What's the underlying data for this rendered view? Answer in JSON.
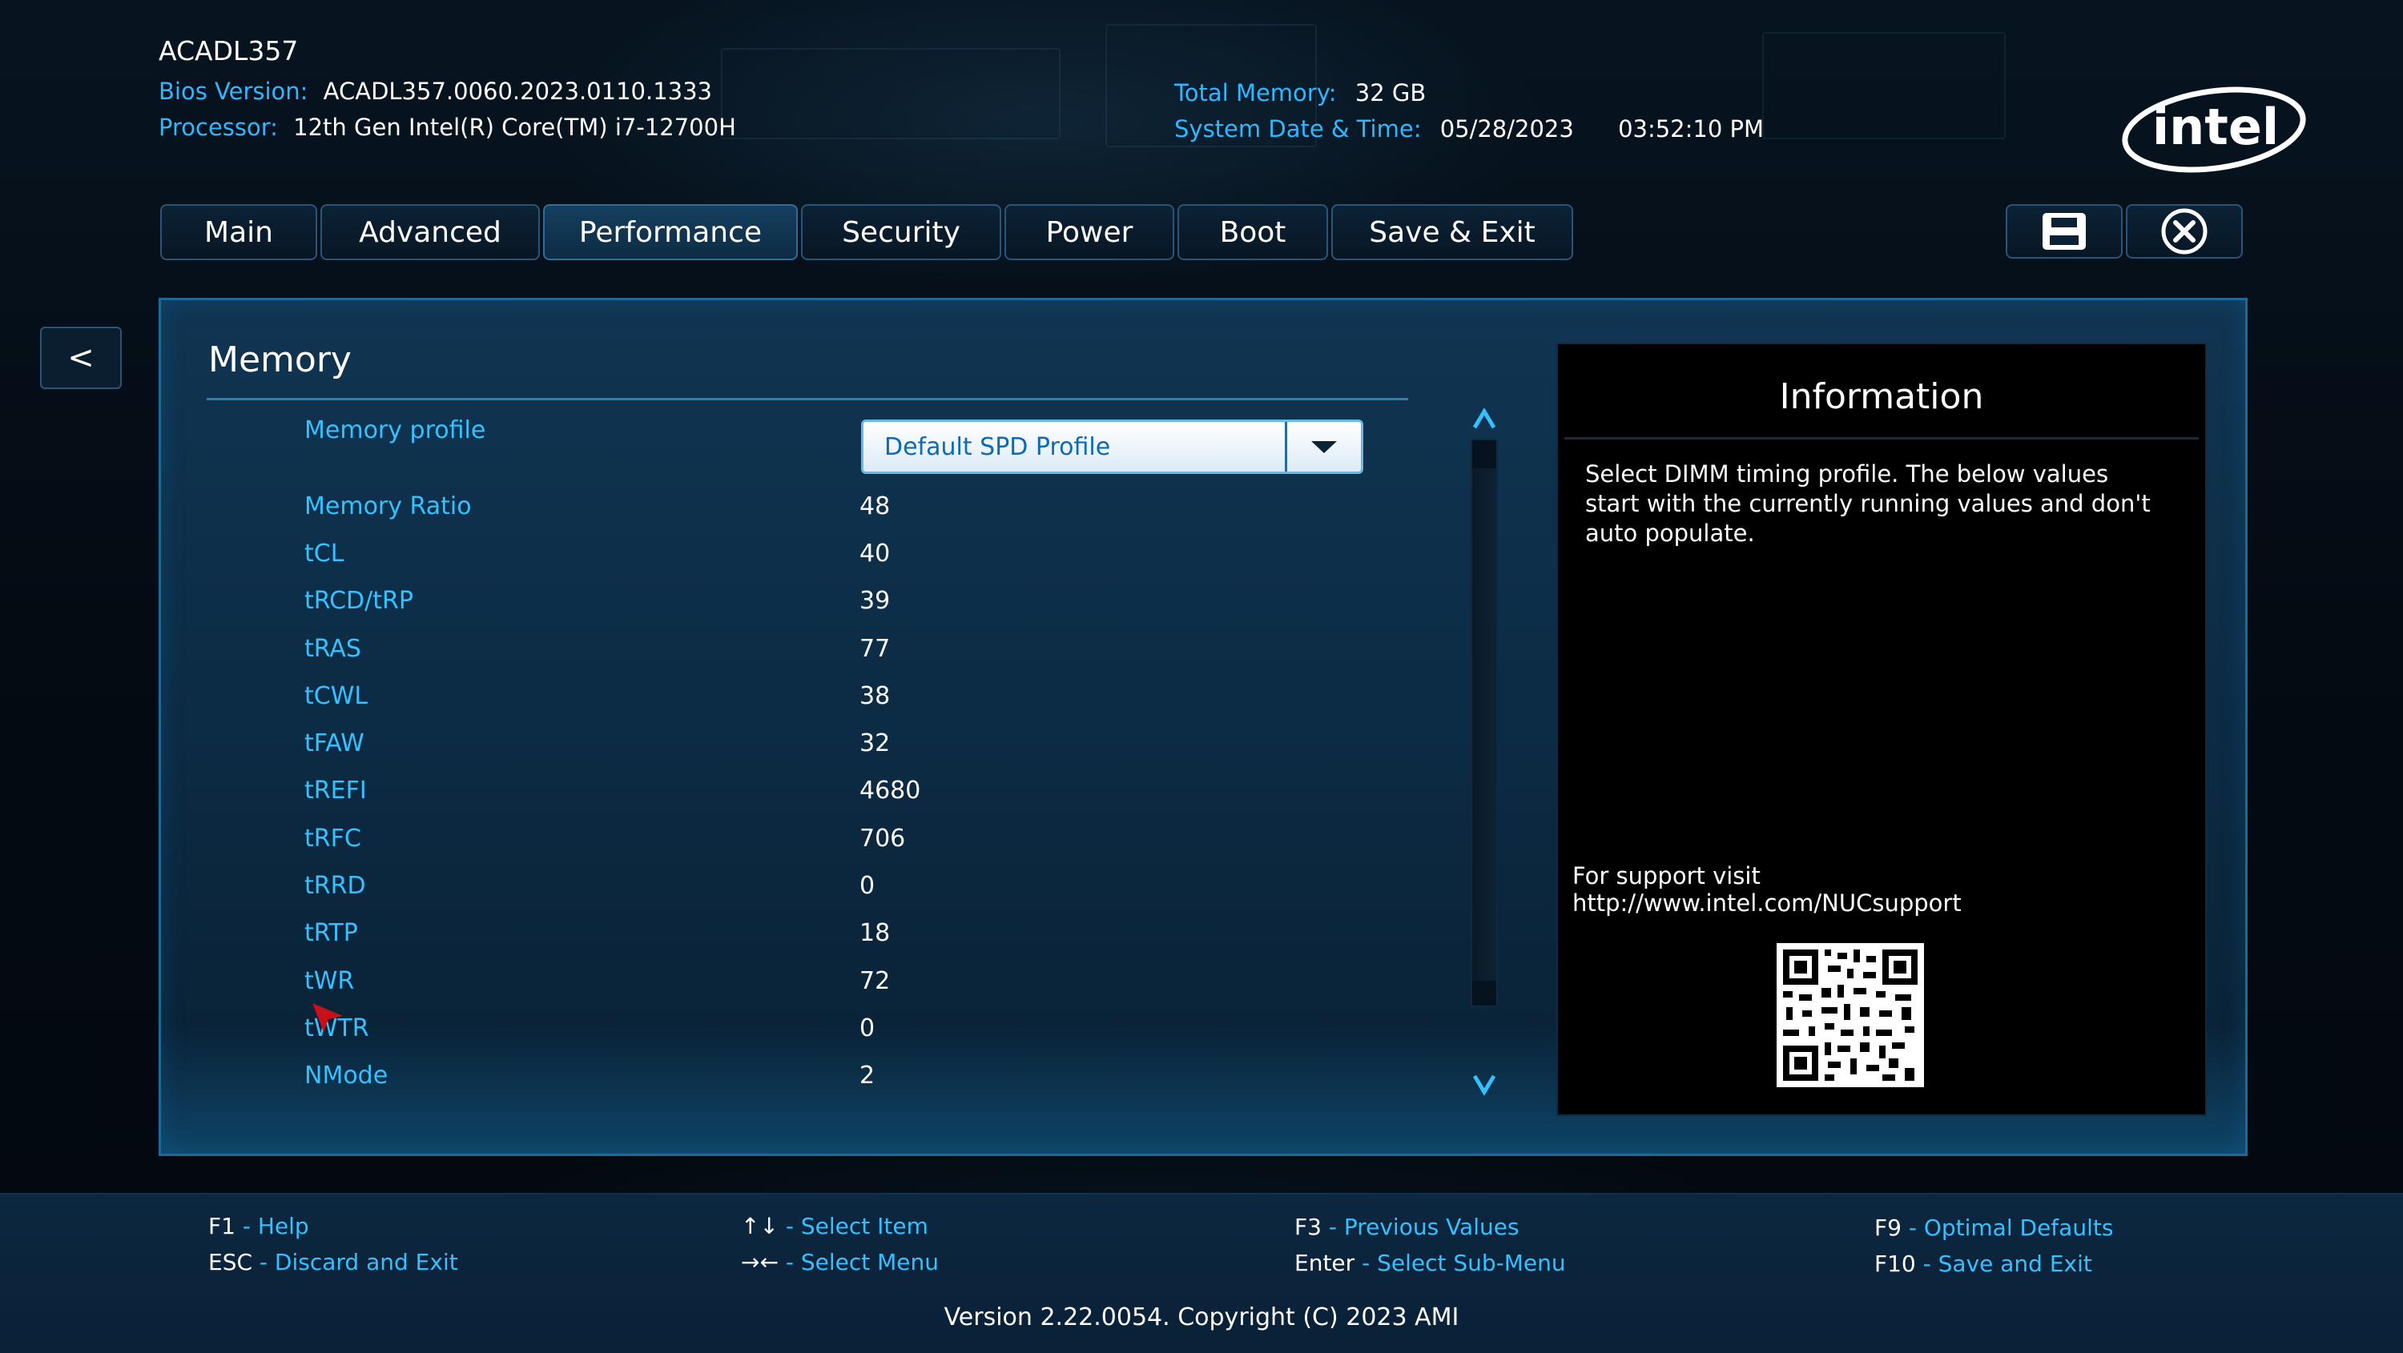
{
  "header": {
    "system_name": "ACADL357",
    "bios_label": "Bios Version:",
    "bios_value": "ACADL357.0060.2023.0110.1333",
    "processor_label": "Processor:",
    "processor_value": "12th Gen Intel(R) Core(TM) i7-12700H",
    "memory_label": "Total Memory:",
    "memory_value": "32 GB",
    "datetime_label": "System Date & Time:",
    "date_value": "05/28/2023",
    "time_value": "03:52:10 PM",
    "logo_text": "intel"
  },
  "tabs": [
    {
      "label": "Main"
    },
    {
      "label": "Advanced"
    },
    {
      "label": "Performance"
    },
    {
      "label": "Security"
    },
    {
      "label": "Power"
    },
    {
      "label": "Boot"
    },
    {
      "label": "Save & Exit"
    }
  ],
  "active_tab": "Performance",
  "toolbar": {
    "save_icon": "floppy-disk-icon",
    "close_icon": "circle-x-icon"
  },
  "back_label": "<",
  "section": {
    "title": "Memory",
    "profile_label": "Memory profile",
    "profile_value": "Default SPD Profile",
    "rows": [
      {
        "label": "Memory Ratio",
        "value": "48"
      },
      {
        "label": "tCL",
        "value": "40"
      },
      {
        "label": "tRCD/tRP",
        "value": "39"
      },
      {
        "label": "tRAS",
        "value": "77"
      },
      {
        "label": "tCWL",
        "value": "38"
      },
      {
        "label": "tFAW",
        "value": "32"
      },
      {
        "label": "tREFI",
        "value": "4680"
      },
      {
        "label": "tRFC",
        "value": "706"
      },
      {
        "label": "tRRD",
        "value": "0"
      },
      {
        "label": "tRTP",
        "value": "18"
      },
      {
        "label": "tWR",
        "value": "72"
      },
      {
        "label": "tWTR",
        "value": "0"
      },
      {
        "label": "NMode",
        "value": "2"
      }
    ]
  },
  "info": {
    "title": "Information",
    "text": "Select DIMM timing profile. The below values start with the currently running values and don't auto populate.",
    "support_line1": "For support visit",
    "support_line2": "http://www.intel.com/NUCsupport"
  },
  "footer": {
    "f1_key": "F1",
    "f1_desc": "- Help",
    "esc_key": "ESC",
    "esc_desc": "- Discard and Exit",
    "select_item_key": "↑↓",
    "select_item_desc": "- Select Item",
    "select_menu_key": "→←",
    "select_menu_desc": "- Select Menu",
    "f3_key": "F3",
    "f3_desc": "- Previous Values",
    "enter_key": "Enter",
    "enter_desc": "- Select Sub-Menu",
    "f9_key": "F9",
    "f9_desc": "- Optimal Defaults",
    "f10_key": "F10",
    "f10_desc": "- Save and Exit",
    "version": "Version 2.22.0054. Copyright (C) 2023 AMI"
  },
  "colors": {
    "accent": "#35c1ff",
    "panel_border": "#1d6a98",
    "background": "#03080e"
  }
}
